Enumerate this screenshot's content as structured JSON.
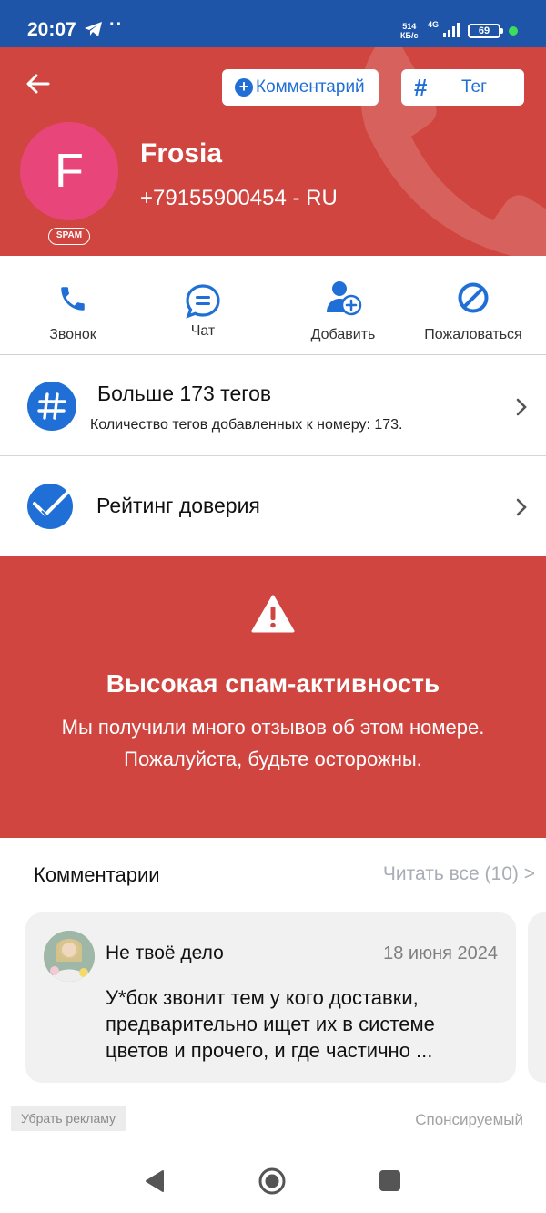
{
  "status_bar": {
    "time": "20:07",
    "dots": "··",
    "speed_top": "514",
    "speed_bottom": "КБ/с",
    "network": "4G",
    "battery": "69"
  },
  "header": {
    "comment_button": "Комментарий",
    "tag_button": "Тег",
    "avatar_letter": "F",
    "spam_badge": "SPAM",
    "contact_name": "Frosia",
    "phone_number": "+79155900454 - RU",
    "accent_color": "#d0453f"
  },
  "actions": [
    {
      "label": "Звонок",
      "icon": "phone-icon"
    },
    {
      "label": "Чат",
      "icon": "chat-icon"
    },
    {
      "label": "Добавить",
      "icon": "add-contact-icon"
    },
    {
      "label": "Пожаловаться",
      "icon": "block-icon"
    }
  ],
  "tags_row": {
    "title": "Больше 173 тегов",
    "subtitle": "Количество тегов добавленных к номеру: 173."
  },
  "trust_row": {
    "title": "Рейтинг доверия"
  },
  "warning": {
    "title": "Высокая спам-активность",
    "line1": "Мы получили много отзывов об этом номере.",
    "line2": "Пожалуйста, будьте осторожны."
  },
  "comments": {
    "header": "Комментарии",
    "read_all": "Читать все (10) >",
    "items": [
      {
        "author": "Не твоё дело",
        "date": "18 июня 2024",
        "text": "У*бок звонит тем у кого доставки, предварительно ищет их в системе цветов и прочего, и где частично ..."
      }
    ]
  },
  "ads": {
    "remove": "Убрать рекламу",
    "sponsored": "Спонсируемый"
  }
}
